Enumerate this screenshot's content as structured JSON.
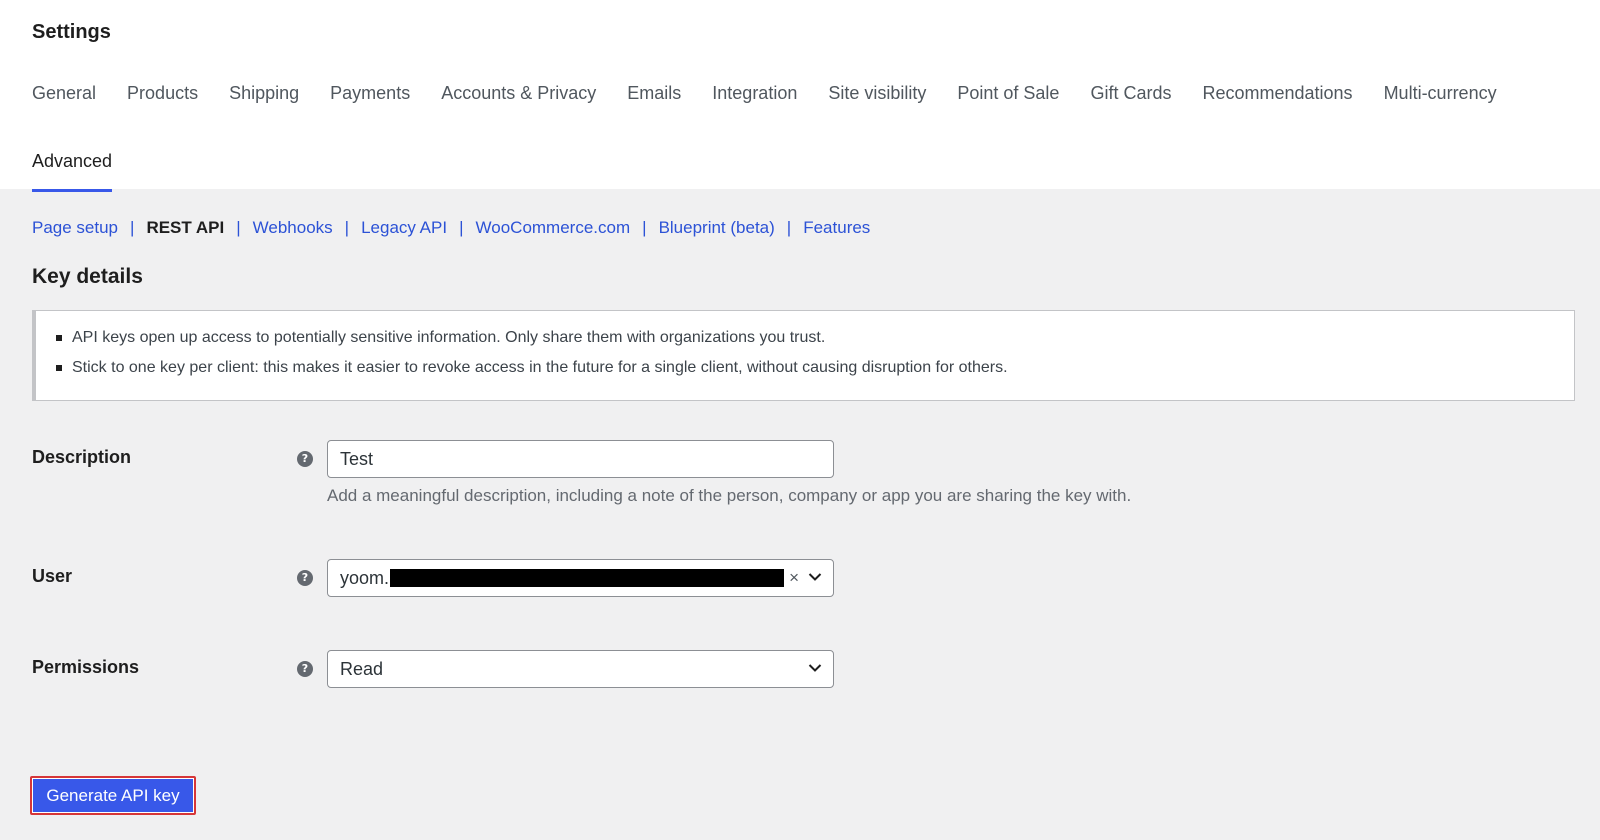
{
  "page": {
    "title": "Settings"
  },
  "tabs": [
    {
      "label": "General"
    },
    {
      "label": "Products"
    },
    {
      "label": "Shipping"
    },
    {
      "label": "Payments"
    },
    {
      "label": "Accounts & Privacy"
    },
    {
      "label": "Emails"
    },
    {
      "label": "Integration"
    },
    {
      "label": "Site visibility"
    },
    {
      "label": "Point of Sale"
    },
    {
      "label": "Gift Cards"
    },
    {
      "label": "Recommendations"
    },
    {
      "label": "Multi-currency"
    },
    {
      "label": "Advanced",
      "active": true
    }
  ],
  "subnav": {
    "items": [
      {
        "label": "Page setup"
      },
      {
        "label": "REST API",
        "current": true
      },
      {
        "label": "Webhooks"
      },
      {
        "label": "Legacy API"
      },
      {
        "label": "WooCommerce.com"
      },
      {
        "label": "Blueprint (beta)"
      },
      {
        "label": "Features"
      }
    ],
    "separator": "|"
  },
  "section": {
    "title": "Key details"
  },
  "notice": {
    "items": [
      "API keys open up access to potentially sensitive information. Only share them with organizations you trust.",
      "Stick to one key per client: this makes it easier to revoke access in the future for a single client, without causing disruption for others."
    ]
  },
  "form": {
    "help_glyph": "?",
    "description": {
      "label": "Description",
      "value": "Test",
      "help_text": "Add a meaningful description, including a note of the person, company or app you are sharing the key with."
    },
    "user": {
      "label": "User",
      "value_visible": "yoom.",
      "clear_glyph": "×"
    },
    "permissions": {
      "label": "Permissions",
      "value": "Read"
    }
  },
  "actions": {
    "generate_label": "Generate API key"
  },
  "colors": {
    "accent": "#3858e9",
    "link": "#2c52d6",
    "highlight_border": "#d63638",
    "background": "#f0f0f1"
  },
  "icons": {
    "help": "question-circle-icon",
    "dropdown": "chevron-down-icon",
    "clear": "close-icon"
  }
}
